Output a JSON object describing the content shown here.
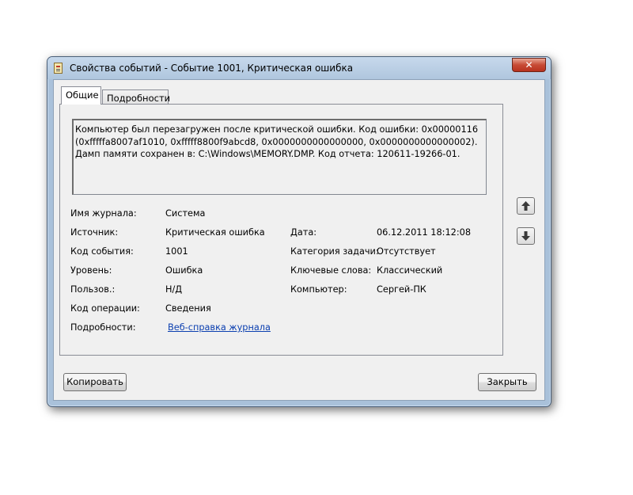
{
  "window": {
    "title": "Свойства событий - Событие 1001, Критическая ошибка"
  },
  "titlebar": {
    "close_glyph": "✕"
  },
  "tabs": [
    {
      "label": "Общие",
      "active": true
    },
    {
      "label": "Подробности",
      "active": false
    }
  ],
  "description": "Компьютер был перезагружен после критической ошибки.  Код ошибки: 0x00000116 (0xfffffa8007af1010, 0xfffff8800f9abcd8, 0x0000000000000000, 0x0000000000000002). Дамп памяти сохранен в: C:\\Windows\\MEMORY.DMP. Код отчета: 120611-19266-01.",
  "fields": {
    "log_name": {
      "label": "Имя журнала:",
      "value": "Система"
    },
    "source": {
      "label": "Источник:",
      "value": "Критическая ошибка"
    },
    "event_id": {
      "label": "Код события:",
      "value": "1001"
    },
    "level": {
      "label": "Уровень:",
      "value": "Ошибка"
    },
    "user": {
      "label": "Пользов.:",
      "value": "Н/Д"
    },
    "opcode": {
      "label": "Код операции:",
      "value": "Сведения"
    },
    "details": {
      "label": "Подробности:",
      "link": "Веб-справка журнала "
    },
    "date": {
      "label": "Дата:",
      "value": "06.12.2011 18:12:08"
    },
    "task_category": {
      "label": "Категория задачи:",
      "value": "Отсутствует"
    },
    "keywords": {
      "label": "Ключевые слова:",
      "value": "Классический"
    },
    "computer": {
      "label": "Компьютер:",
      "value": "Сергей-ПК"
    }
  },
  "nav": {
    "up_icon": "arrow-up-icon",
    "down_icon": "arrow-down-icon"
  },
  "buttons": {
    "copy": "Копировать",
    "close": "Закрыть"
  },
  "colors": {
    "titlebar": "#b9cfe6",
    "close_button": "#c74a35",
    "link": "#0b3fb0"
  }
}
